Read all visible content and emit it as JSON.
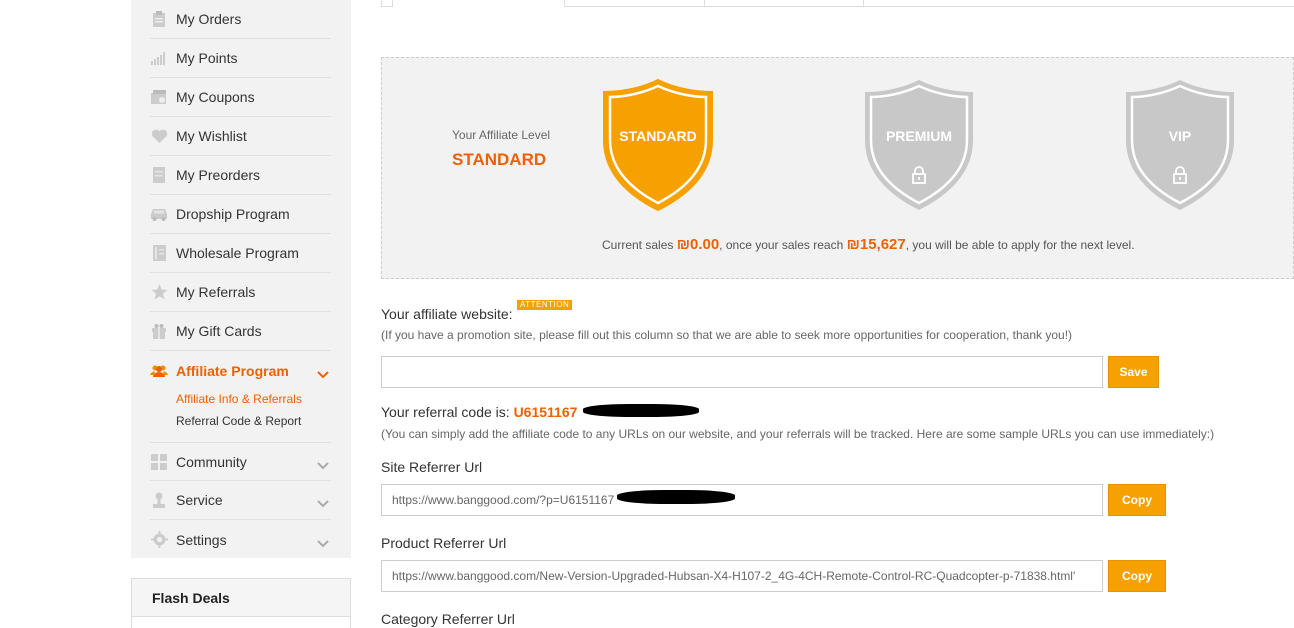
{
  "sidebar": {
    "items": [
      {
        "label": "My Orders",
        "icon": "clipboard-icon"
      },
      {
        "label": "My Points",
        "icon": "bar-chart-icon"
      },
      {
        "label": "My Coupons",
        "icon": "coupon-icon"
      },
      {
        "label": "My Wishlist",
        "icon": "heart-icon"
      },
      {
        "label": "My Preorders",
        "icon": "document-icon"
      },
      {
        "label": "Dropship Program",
        "icon": "car-icon"
      },
      {
        "label": "Wholesale Program",
        "icon": "book-icon"
      },
      {
        "label": "My Referrals",
        "icon": "star-icon"
      },
      {
        "label": "My Gift Cards",
        "icon": "gift-icon"
      }
    ],
    "affiliate": {
      "label": "Affiliate Program",
      "icon": "people-icon",
      "sub": [
        "Affiliate Info & Referrals",
        "Referral Code & Report"
      ]
    },
    "bottom_items": [
      {
        "label": "Community",
        "icon": "grid-icon"
      },
      {
        "label": "Service",
        "icon": "person-icon"
      },
      {
        "label": "Settings",
        "icon": "gear-icon"
      }
    ]
  },
  "flash_deals": {
    "title": "Flash Deals"
  },
  "level": {
    "label": "Your Affiliate Level",
    "current": "STANDARD",
    "tiers": [
      "STANDARD",
      "PREMIUM",
      "VIP"
    ],
    "colors": {
      "active": "#f7a100",
      "locked": "#c8c8c8"
    },
    "sales_prefix": "Current sales",
    "current_sales": "₪0.00",
    "sales_middle": ", once your sales reach",
    "target_sales": "₪15,627",
    "sales_suffix": ", you will be able to apply for the next level."
  },
  "affiliate_site": {
    "title": "Your affiliate website:",
    "badge": "ATTENTION",
    "hint": "(If you have a promotion site, please fill out this column so that we are able to seek more opportunities for cooperation, thank you!)",
    "value": "",
    "save_label": "Save"
  },
  "referral": {
    "title": "Your referral code is:",
    "code": "U6151167",
    "hint": "(You can simply add the affiliate code to any URLs on our website, and your referrals will be tracked. Here are some sample URLs you can use immediately:)"
  },
  "site_url": {
    "title": "Site Referrer Url",
    "value": "https://www.banggood.com/?p=U6151167",
    "copy_label": "Copy"
  },
  "product_url": {
    "title": "Product Referrer Url",
    "value": "https://www.banggood.com/New-Version-Upgraded-Hubsan-X4-H107-2_4G-4CH-Remote-Control-RC-Quadcopter-p-71838.html'",
    "copy_label": "Copy"
  },
  "category_url": {
    "title": "Category Referrer Url"
  }
}
